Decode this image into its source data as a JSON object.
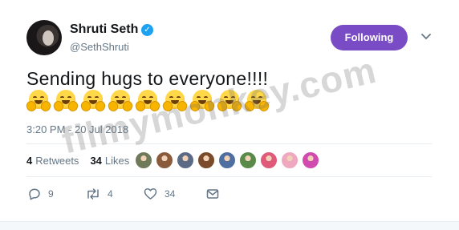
{
  "user": {
    "name": "Shruti Seth",
    "handle": "@SethShruti",
    "verified": true,
    "verified_glyph": "✓"
  },
  "follow_button": {
    "label": "Following",
    "color": "#794bc4"
  },
  "tweet": {
    "text": "Sending hugs to everyone!!!!",
    "emoji": [
      "hugging-face",
      "hugging-face",
      "hugging-face",
      "hugging-face",
      "hugging-face",
      "hugging-face",
      "hugging-face",
      "hugging-face",
      "hugging-face"
    ],
    "timestamp": "3:20 PM - 20 Jul 2018"
  },
  "stats": {
    "retweets_count": "4",
    "retweets_label": "Retweets",
    "likes_count": "34",
    "likes_label": "Likes"
  },
  "likers": [
    {
      "color": "#6f7a5a"
    },
    {
      "color": "#8a5a3c"
    },
    {
      "color": "#5b6b85"
    },
    {
      "color": "#7a4a2a"
    },
    {
      "color": "#4f6fa0"
    },
    {
      "color": "#5a8a4a"
    },
    {
      "color": "#e05a7a"
    },
    {
      "color": "#f0a8c0"
    },
    {
      "color": "#d04ab0"
    }
  ],
  "actions": {
    "reply_count": "9",
    "retweet_count": "4",
    "like_count": "34"
  },
  "watermark": "filmymonkey.com",
  "colors": {
    "accent": "#1da1f2",
    "muted": "#657786",
    "text": "#14171a"
  }
}
